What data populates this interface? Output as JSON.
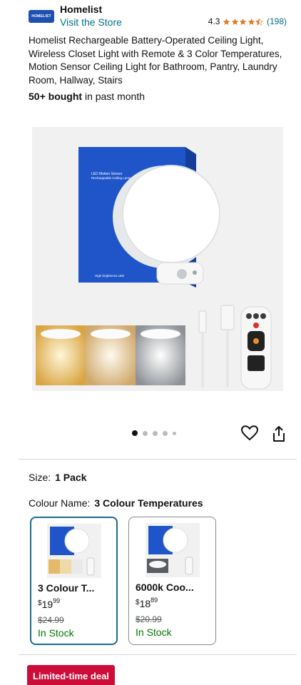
{
  "header": {
    "brand_logo_text": "HOMELIST",
    "brand": "Homelist",
    "store_link": "Visit the Store",
    "rating": "4.3",
    "rating_value": 4.3,
    "review_count": "(198)",
    "star_color": "#de7921"
  },
  "product": {
    "title": "Homelist Rechargeable Battery-Operated Ceiling Light, Wireless Closet Light with Remote & 3 Color Temperatures, Motion Sensor Ceiling Light for Bathroom, Pantry, Laundry Room, Hallway, Stairs",
    "bought_bold": "50+ bought",
    "bought_rest": " in past month"
  },
  "gallery": {
    "box_text_1": "LED Motion Sensor",
    "box_text_2": "Rechargeable Ceiling Lamp",
    "box_text_3": "High brightness LED",
    "image_count": 5,
    "active_index": 0
  },
  "variations": {
    "size_label": "Size:",
    "size_value": "1 Pack",
    "colour_label": "Colour Name:",
    "colour_value": "3 Colour Temperatures",
    "options": [
      {
        "name": "3 Colour T...",
        "price_currency": "$",
        "price_whole": "19",
        "price_fraction": "99",
        "was_price": "$24.99",
        "stock": "In Stock"
      },
      {
        "name": "6000k Coo...",
        "price_currency": "$",
        "price_whole": "18",
        "price_fraction": "89",
        "was_price": "$20.99",
        "stock": "In Stock"
      }
    ]
  },
  "deal_badge": "Limited-time deal",
  "colors": {
    "link": "#007185",
    "in_stock": "#007600",
    "deal": "#cc0c39",
    "selected_border": "#1a6b8a",
    "box_blue": "#1f55c8"
  }
}
